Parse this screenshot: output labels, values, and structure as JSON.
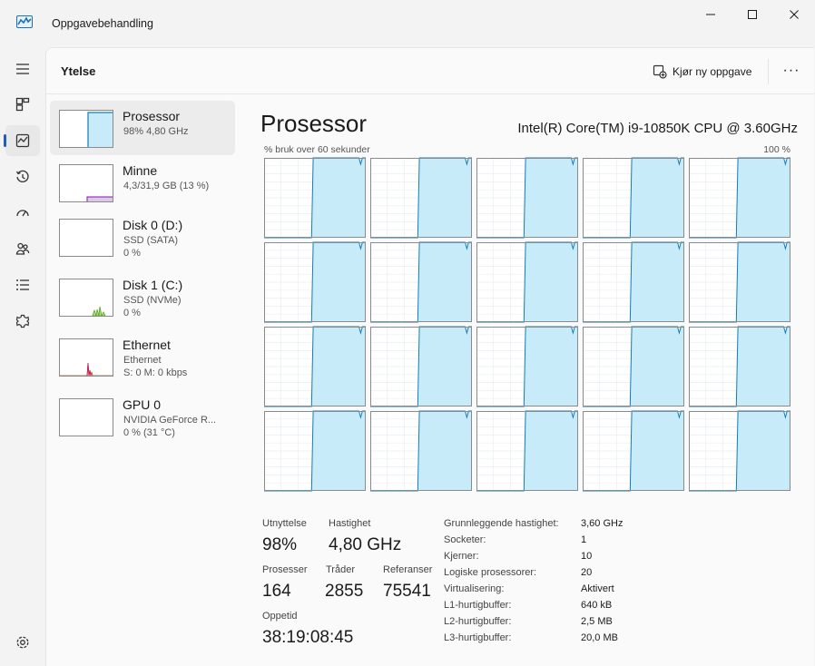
{
  "window": {
    "title": "Oppgavebehandling",
    "minimize_glyph": "—",
    "maximize_glyph": "☐",
    "close_glyph": "✕"
  },
  "nav": {
    "items": [
      {
        "icon": "hamburger-menu-icon"
      },
      {
        "icon": "processes-icon"
      },
      {
        "icon": "performance-icon",
        "active": true
      },
      {
        "icon": "app-history-icon"
      },
      {
        "icon": "startup-apps-icon"
      },
      {
        "icon": "users-icon"
      },
      {
        "icon": "details-icon"
      },
      {
        "icon": "services-icon"
      }
    ],
    "settings_icon": "settings-icon"
  },
  "header": {
    "title": "Ytelse",
    "run_task_label": "Kjør ny oppgave",
    "more_label": "···"
  },
  "sidebar": {
    "items": [
      {
        "name": "Prosessor",
        "sub1": "98% 4,80 GHz",
        "sub2": ""
      },
      {
        "name": "Minne",
        "sub1": "4,3/31,9 GB (13 %)",
        "sub2": ""
      },
      {
        "name": "Disk 0 (D:)",
        "sub1": "SSD (SATA)",
        "sub2": "0 %"
      },
      {
        "name": "Disk 1 (C:)",
        "sub1": "SSD (NVMe)",
        "sub2": "0 %"
      },
      {
        "name": "Ethernet",
        "sub1": "Ethernet",
        "sub2": "S: 0 M: 0 kbps"
      },
      {
        "name": "GPU 0",
        "sub1": "NVIDIA GeForce R...",
        "sub2": "0 % (31 °C)"
      }
    ]
  },
  "main": {
    "title": "Prosessor",
    "cpu_model": "Intel(R) Core(TM) i9-10850K CPU @ 3.60GHz",
    "graph_caption": "% bruk over 60 sekunder",
    "graph_max": "100 %"
  },
  "chart_data": {
    "type": "area",
    "title": "",
    "xlabel": "% bruk over 60 sekunder",
    "ylabel": "",
    "ylim": [
      0,
      100
    ],
    "x_range_seconds": [
      0,
      60
    ],
    "logical_processor_count": 20,
    "grid": true,
    "series_color": "#117dbb",
    "fill_color": "#c8ebfa",
    "usage_profile": {
      "x": [
        0,
        28,
        29,
        56,
        57,
        58,
        59,
        60
      ],
      "y": [
        0,
        0,
        100,
        100,
        92,
        100,
        100,
        100
      ]
    }
  },
  "stats": {
    "utilization_label": "Utnyttelse",
    "utilization_value": "98%",
    "speed_label": "Hastighet",
    "speed_value": "4,80 GHz",
    "processes_label": "Prosesser",
    "processes_value": "164",
    "threads_label": "Tråder",
    "threads_value": "2855",
    "handles_label": "Referanser",
    "handles_value": "75541",
    "uptime_label": "Oppetid",
    "uptime_value": "38:19:08:45"
  },
  "specs": [
    {
      "label": "Grunnleggende hastighet:",
      "value": "3,60 GHz"
    },
    {
      "label": "Socketer:",
      "value": "1"
    },
    {
      "label": "Kjerner:",
      "value": "10"
    },
    {
      "label": "Logiske prosessorer:",
      "value": "20"
    },
    {
      "label": "Virtualisering:",
      "value": "Aktivert"
    },
    {
      "label": "L1-hurtigbuffer:",
      "value": "640 kB"
    },
    {
      "label": "L2-hurtigbuffer:",
      "value": "2,5 MB"
    },
    {
      "label": "L3-hurtigbuffer:",
      "value": "20,0 MB"
    }
  ]
}
